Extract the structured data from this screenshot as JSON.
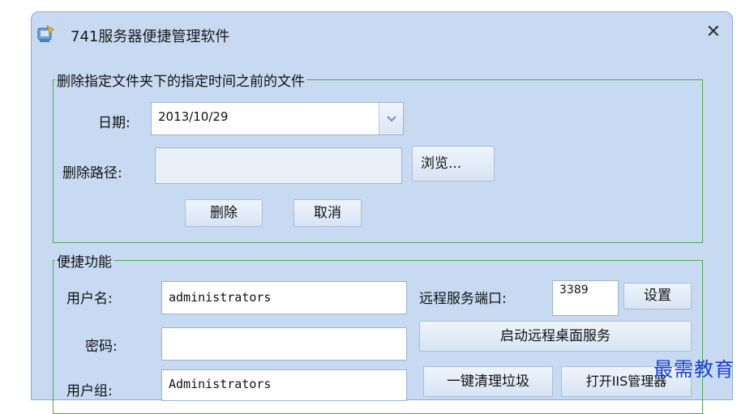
{
  "window": {
    "title": "741服务器便捷管理软件"
  },
  "delete_group": {
    "legend": "删除指定文件夹下的指定时间之前的文件",
    "date_label": "日期:",
    "date_value": "2013/10/29",
    "path_label": "删除路径:",
    "path_value": "",
    "browse_label": "浏览...",
    "delete_label": "删除",
    "cancel_label": "取消"
  },
  "quick_group": {
    "legend": "便捷功能",
    "username_label": "用户名:",
    "username_value": "administrators",
    "password_label": "密码:",
    "password_value": "",
    "usergroup_label": "用户组:",
    "usergroup_value": "Administrators",
    "port_label": "远程服务端口:",
    "port_value": "3389",
    "set_label": "设置",
    "start_rdp_label": "启动远程桌面服务",
    "clean_label": "一键清理垃圾",
    "iis_label": "打开IIS管理器"
  },
  "watermark": "最需教育",
  "colors": {
    "window_bg": "#c7daf2",
    "group_border": "#4bab4b",
    "watermark": "#1c3fcf"
  },
  "icons": {
    "app": "computer-box-icon",
    "close": "close-icon",
    "dropdown": "chevron-down-icon"
  }
}
